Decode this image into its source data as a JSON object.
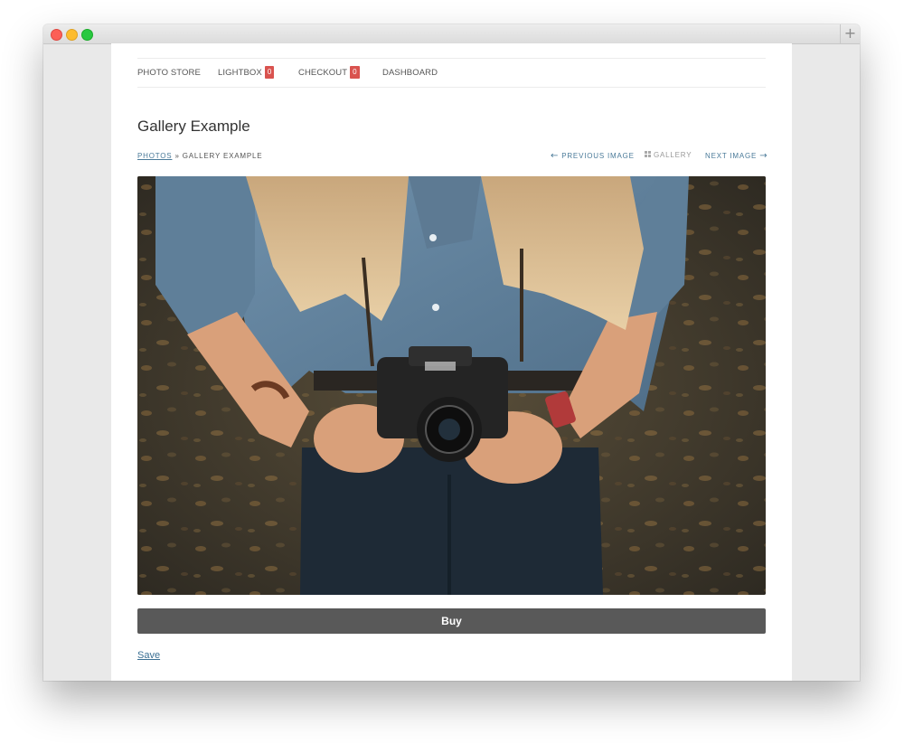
{
  "nav": {
    "items": [
      {
        "label": "PHOTO STORE"
      },
      {
        "label": "LIGHTBOX",
        "badge": "0"
      },
      {
        "label": "CHECKOUT",
        "badge": "0"
      },
      {
        "label": "DASHBOARD"
      }
    ]
  },
  "page": {
    "title": "Gallery Example"
  },
  "breadcrumb": {
    "link": "PHOTOS",
    "separator": "»",
    "current": "GALLERY EXAMPLE"
  },
  "image_nav": {
    "previous": "PREVIOUS IMAGE",
    "gallery": "GALLERY",
    "next": "NEXT IMAGE"
  },
  "actions": {
    "buy": "Buy",
    "save": "Save"
  },
  "colors": {
    "badge": "#d9534f",
    "link": "#4a7a99",
    "button": "#595959"
  },
  "icons": [
    "arrow-left-icon",
    "grid-icon",
    "arrow-right-icon",
    "plus-icon"
  ]
}
